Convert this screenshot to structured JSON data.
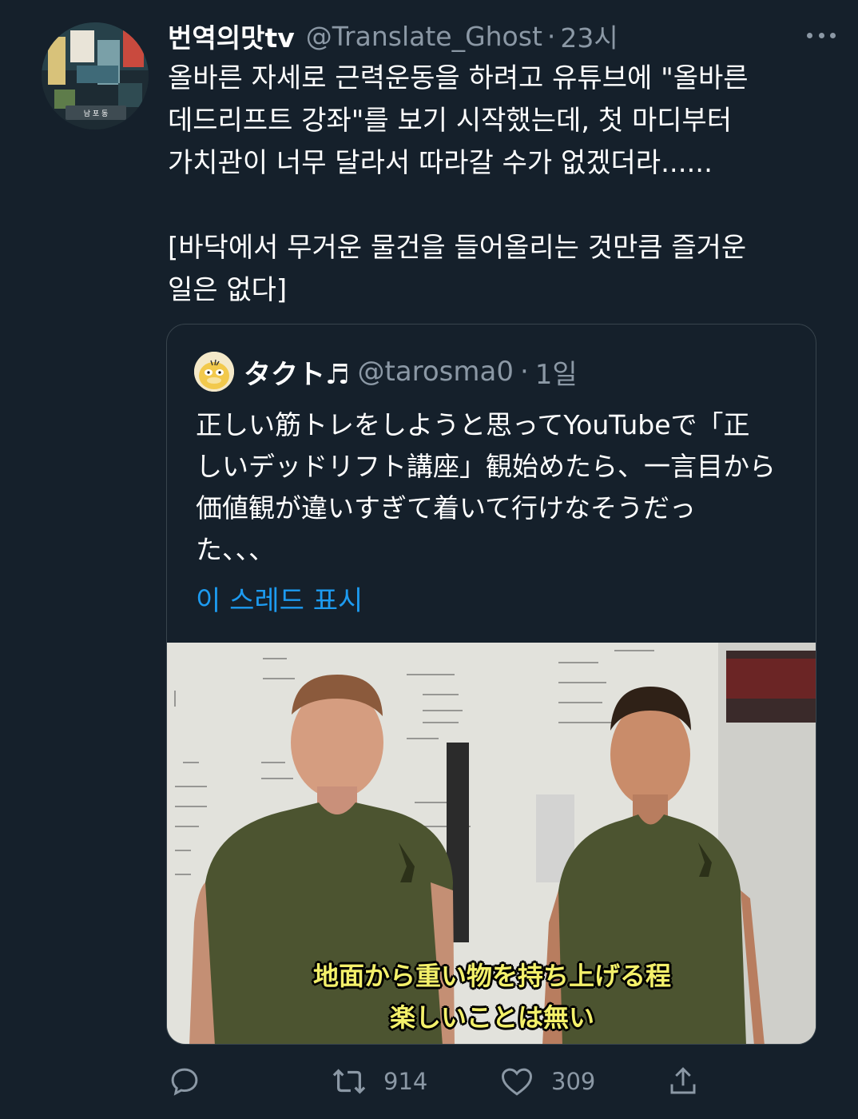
{
  "author": {
    "display_name": "번역의맛tv",
    "handle": "@Translate_Ghost",
    "time": "23시",
    "avatar_sign": "남 포 동"
  },
  "tweet": {
    "text": "올바른 자세로 근력운동을 하려고 유튜브에 \"올바른\n데드리프트 강좌\"를 보기 시작했는데, 첫 마디부터\n가치관이 너무 달라서 따라갈 수가 없겠더라......\n\n[바닥에서 무거운 물건을 들어올리는 것만큼 즐거운\n일은 없다]"
  },
  "quote": {
    "display_name": "タクト♬",
    "handle": "@tarosma0",
    "time": "1일",
    "text": "正しい筋トレをしようと思ってYouTubeで「正\nしいデッドリフト講座」観始めたら、一言目から\n価値観が違いすぎて着いて行けなそうだっ\nた、、、",
    "show_thread": "이 스레드 표시",
    "subtitle_line1": "地面から重い物を持ち上げる程",
    "subtitle_line2": "楽しいことは無い"
  },
  "actions": {
    "retweets": "914",
    "likes": "309"
  },
  "separator": "·",
  "colors": {
    "background": "#15202b",
    "secondary_text": "#8b98a5",
    "link": "#1d9bf0",
    "subtitle": "#f3f06a"
  }
}
